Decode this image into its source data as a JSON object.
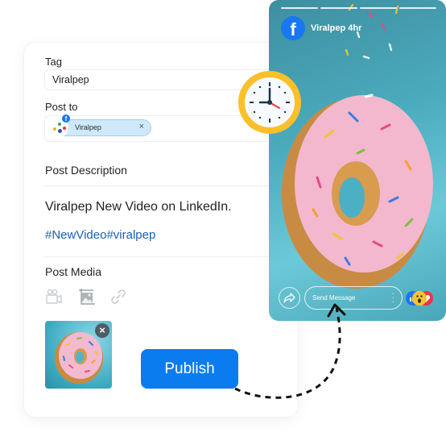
{
  "form": {
    "tag_label": "Tag",
    "tag_value": "Viralpep",
    "post_to_label": "Post to",
    "post_to_chip": "Viralpep",
    "chip_close": "×",
    "post_description_label": "Post Description",
    "description_text": "Viralpep New Video on LinkedIn.",
    "hashtags": "#NewVideo#viralpep",
    "post_media_label": "Post Media",
    "media_icons": [
      "video-camera-icon",
      "image-icon",
      "link-icon"
    ],
    "thumbnail_close": "×",
    "publish_label": "Publish"
  },
  "story_preview": {
    "platform": "Facebook",
    "fb_glyph": "f",
    "user_and_time": "Viralpep 4hr",
    "progress_segments": 4,
    "message_placeholder": "Send Message",
    "menu_glyph": "⋮",
    "reactions": [
      "like",
      "wow",
      "love"
    ]
  },
  "colors": {
    "publish": "#0a7cf0",
    "hashtag": "#1a5fb4",
    "facebook": "#1877f2",
    "clock_ring": "#fbbf2a",
    "chip_bg": "#cfe9fb"
  }
}
